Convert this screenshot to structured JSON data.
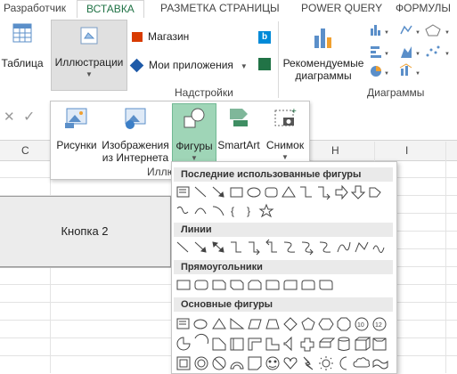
{
  "tabs": [
    "Разработчик",
    "ВСТАВКА",
    "РАЗМЕТКА СТРАНИЦЫ",
    "POWER QUERY",
    "ФОРМУЛЫ"
  ],
  "ribbon": {
    "table_label": "Таблица",
    "illustrations_label": "Иллюстрации",
    "store_label": "Магазин",
    "myapps_label": "Мои приложения",
    "addins_group": "Надстройки",
    "recommended_label_1": "Рекомендуемые",
    "recommended_label_2": "диаграммы",
    "charts_group": "Диаграммы"
  },
  "illustrations_menu": {
    "pictures": "Рисунки",
    "online_1": "Изображения",
    "online_2": "из Интернета",
    "shapes": "Фигуры",
    "smartart": "SmartArt",
    "screenshot": "Снимок",
    "group_partial": "Иллю"
  },
  "sheet": {
    "col_c": "C",
    "col_h": "H",
    "col_i": "I",
    "button_label": "Кнопка 2"
  },
  "shapes_menu": {
    "recent": "Последние использованные фигуры",
    "lines": "Линии",
    "rectangles": "Прямоугольники",
    "basic": "Основные фигуры"
  },
  "colors": {
    "accent": "#217346",
    "shapes_highlight": "#9fd5b7"
  }
}
